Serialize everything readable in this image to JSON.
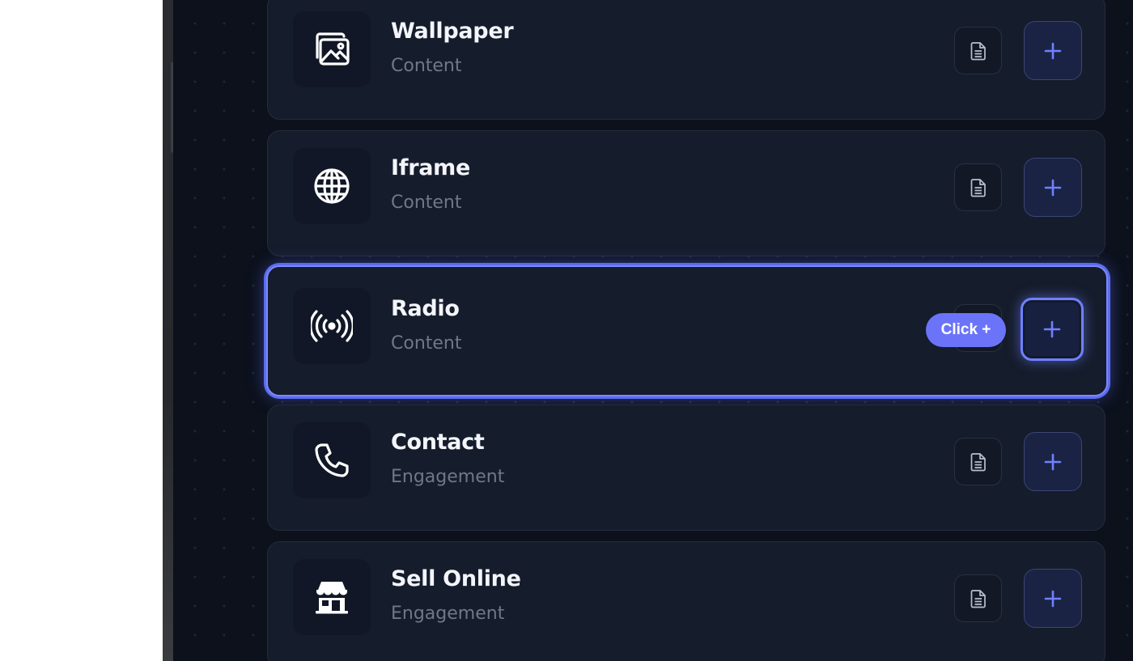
{
  "colors": {
    "accent": "#6b74f8",
    "plus": "#7080ff",
    "highlight_border": "#7b88ff",
    "card_bg": "#151c2b",
    "page_bg": "#0c111c"
  },
  "items": [
    {
      "title": "Wallpaper",
      "category": "Content",
      "icon": "image-icon"
    },
    {
      "title": "Iframe",
      "category": "Content",
      "icon": "globe-icon"
    },
    {
      "title": "Radio",
      "category": "Content",
      "icon": "broadcast-icon",
      "highlighted": true
    },
    {
      "title": "Contact",
      "category": "Engagement",
      "icon": "phone-icon"
    },
    {
      "title": "Sell Online",
      "category": "Engagement",
      "icon": "store-icon"
    }
  ],
  "tooltip": {
    "label": "Click +"
  },
  "buttons": {
    "add_icon": "plus-icon",
    "details_icon": "document-icon"
  }
}
